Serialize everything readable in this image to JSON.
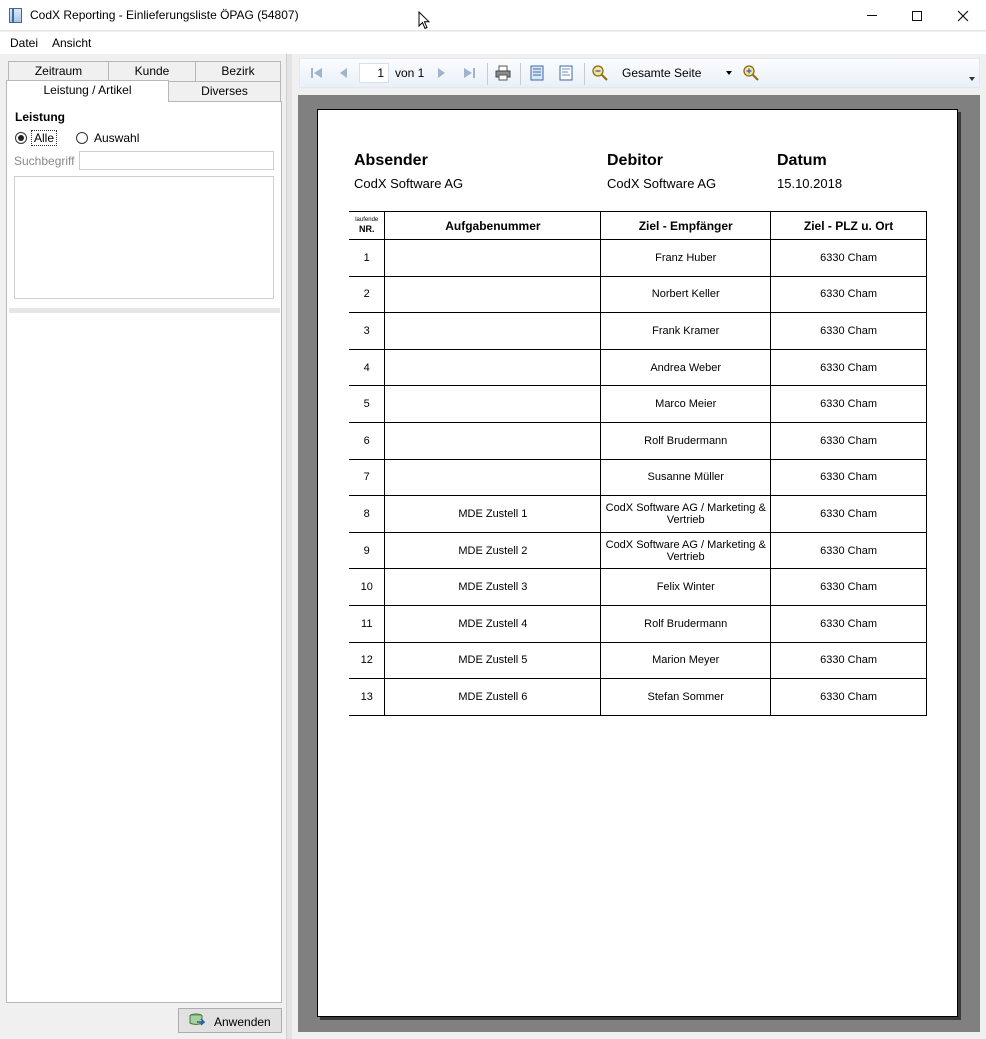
{
  "window": {
    "title": "CodX Reporting - Einlieferungsliste ÖPAG (54807)"
  },
  "menu": {
    "datei": "Datei",
    "ansicht": "Ansicht"
  },
  "left_panel": {
    "tabs": {
      "zeitraum": "Zeitraum",
      "kunde": "Kunde",
      "bezirk": "Bezirk",
      "leistung_artikel": "Leistung / Artikel",
      "diverses": "Diverses"
    },
    "section_label": "Leistung",
    "radio_alle": "Alle",
    "radio_auswahl": "Auswahl",
    "selected_radio": "Alle",
    "search_label": "Suchbegriff",
    "search_value": "",
    "apply_button": "Anwenden"
  },
  "viewer_toolbar": {
    "current_page": "1",
    "page_of": "von 1",
    "zoom_value": "Gesamte Seite"
  },
  "report": {
    "absender_label": "Absender",
    "absender_value": "CodX Software AG",
    "debitor_label": "Debitor",
    "debitor_value": "CodX Software AG",
    "datum_label": "Datum",
    "datum_value": "15.10.2018",
    "columns": {
      "nr_small": "laufende",
      "nr": "NR.",
      "aufgabe": "Aufgabenummer",
      "ziel": "Ziel - Empfänger",
      "plz": "Ziel - PLZ u. Ort"
    },
    "rows": [
      {
        "nr": "1",
        "aufgabe": "",
        "ziel": "Franz Huber",
        "plz": "6330 Cham"
      },
      {
        "nr": "2",
        "aufgabe": "",
        "ziel": "Norbert Keller",
        "plz": "6330 Cham"
      },
      {
        "nr": "3",
        "aufgabe": "",
        "ziel": "Frank Kramer",
        "plz": "6330 Cham"
      },
      {
        "nr": "4",
        "aufgabe": "",
        "ziel": "Andrea Weber",
        "plz": "6330 Cham"
      },
      {
        "nr": "5",
        "aufgabe": "",
        "ziel": "Marco Meier",
        "plz": "6330 Cham"
      },
      {
        "nr": "6",
        "aufgabe": "",
        "ziel": "Rolf Brudermann",
        "plz": "6330 Cham"
      },
      {
        "nr": "7",
        "aufgabe": "",
        "ziel": "Susanne Müller",
        "plz": "6330 Cham"
      },
      {
        "nr": "8",
        "aufgabe": "MDE Zustell 1",
        "ziel": "CodX Software AG   / Marketing & Vertrieb",
        "plz": "6330 Cham"
      },
      {
        "nr": "9",
        "aufgabe": "MDE Zustell 2",
        "ziel": "CodX Software AG   / Marketing & Vertrieb",
        "plz": "6330 Cham"
      },
      {
        "nr": "10",
        "aufgabe": "MDE Zustell 3",
        "ziel": "Felix Winter",
        "plz": "6330 Cham"
      },
      {
        "nr": "11",
        "aufgabe": "MDE Zustell 4",
        "ziel": "Rolf Brudermann",
        "plz": "6330 Cham"
      },
      {
        "nr": "12",
        "aufgabe": "MDE Zustell 5",
        "ziel": "Marion Meyer",
        "plz": "6330 Cham"
      },
      {
        "nr": "13",
        "aufgabe": "MDE Zustell 6",
        "ziel": "Stefan Sommer",
        "plz": "6330 Cham"
      }
    ]
  }
}
